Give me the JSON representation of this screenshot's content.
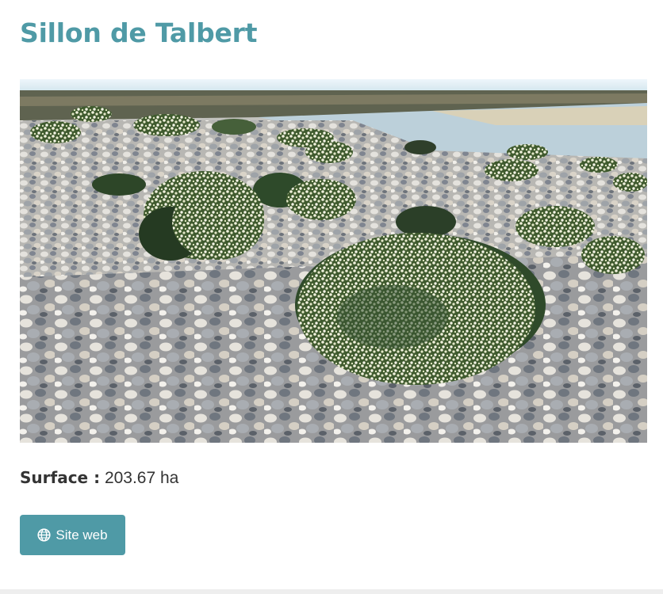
{
  "site": {
    "title": "Sillon de Talbert",
    "photo_subject": "Sillon de Talbert",
    "surface_label": "Surface :",
    "surface_value": "203.67 ha",
    "website_button": {
      "label": "Site web",
      "icon": "globe-icon"
    }
  },
  "colors": {
    "accent": "#4f9aa6",
    "text": "#333333",
    "button_text": "#ffffff"
  }
}
